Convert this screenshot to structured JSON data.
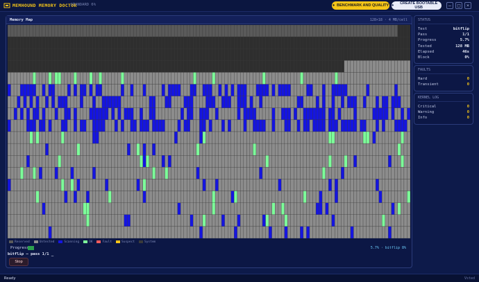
{
  "app": {
    "title": "MEMHOUND MEMORY DOCTOR",
    "subtitle": "· STANDARD 6%"
  },
  "toolbar": {
    "benchmark_label": "BENCHMARK AND QUALITY",
    "usb_label": "CREATE BOOTABLE USB"
  },
  "window": {
    "minimize": "–",
    "maximize": "□",
    "close": "×"
  },
  "map": {
    "title": "Memory Map",
    "info": "128×18 · 4 MB/cell"
  },
  "legend": [
    {
      "label": "Reserved",
      "color": "#5a5a5a"
    },
    {
      "label": "Untested",
      "color": "#8c8c8c"
    },
    {
      "label": "Scanning",
      "color": "#1515e0"
    },
    {
      "label": "OK",
      "color": "#7dff9a"
    },
    {
      "label": "Fault",
      "color": "#ff5c5c"
    },
    {
      "label": "Suspect",
      "color": "#f5c518"
    },
    {
      "label": "System",
      "color": "#3a3a3a"
    }
  ],
  "progress": {
    "label": "Progress",
    "value_text": "5.7% · bitflip 8%",
    "fraction": 0.057
  },
  "command_line": "bitflip – pass 1/1 _",
  "stop_label": "Stop",
  "status": {
    "title": "STATUS",
    "rows": [
      {
        "k": "Test",
        "v": "bitflip"
      },
      {
        "k": "Pass",
        "v": "1/1"
      },
      {
        "k": "Progress",
        "v": "5.7%"
      },
      {
        "k": "Tested",
        "v": "128 MB"
      },
      {
        "k": "Elapsed",
        "v": "46s"
      },
      {
        "k": "Block",
        "v": "0%"
      }
    ]
  },
  "faults": {
    "title": "FAULTS",
    "rows": [
      {
        "k": "Hard",
        "v": "0"
      },
      {
        "k": "Transient",
        "v": "0"
      }
    ]
  },
  "kernel_log": {
    "title": "KERNEL LOG",
    "rows": [
      {
        "k": "Critical",
        "v": "0"
      },
      {
        "k": "Warning",
        "v": "0"
      },
      {
        "k": "Info",
        "v": "0"
      }
    ]
  },
  "statusbar": {
    "left": "Ready",
    "right": "Vsted"
  },
  "colors": {
    "reserved": "#5a5a5a",
    "untested": "#8c8c8c",
    "scanning": "#1515e0",
    "ok": "#7dff9a",
    "dark": "#2e2e2e",
    "accent": "#f5c518"
  }
}
